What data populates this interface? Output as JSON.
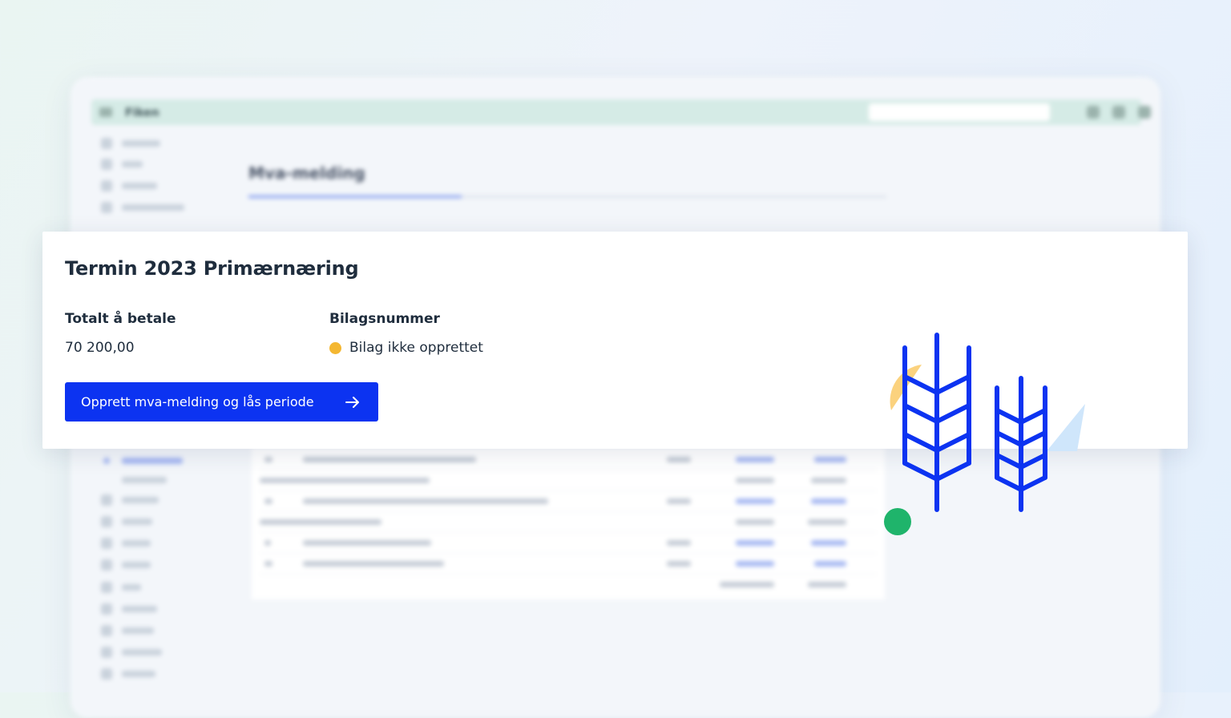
{
  "background_app": {
    "brand": "Fiken",
    "title": "Mva-melding"
  },
  "card": {
    "title": "Termin 2023 Primærnæring",
    "total_label": "Totalt å betale",
    "total_value": "70 200,00",
    "voucher_label": "Bilagsnummer",
    "voucher_status": "Bilag ikke opprettet",
    "voucher_status_color": "#f4b731",
    "primary_button_label": "Opprett mva-melding og lås periode",
    "primary_color": "#0c33f1"
  },
  "decoration": {
    "icon": "wheat-icon",
    "colors": {
      "wheat": "#0c33f1",
      "yellow": "#fbd27e",
      "green": "#1fb46b",
      "lightblue": "#cfe6fb"
    }
  }
}
